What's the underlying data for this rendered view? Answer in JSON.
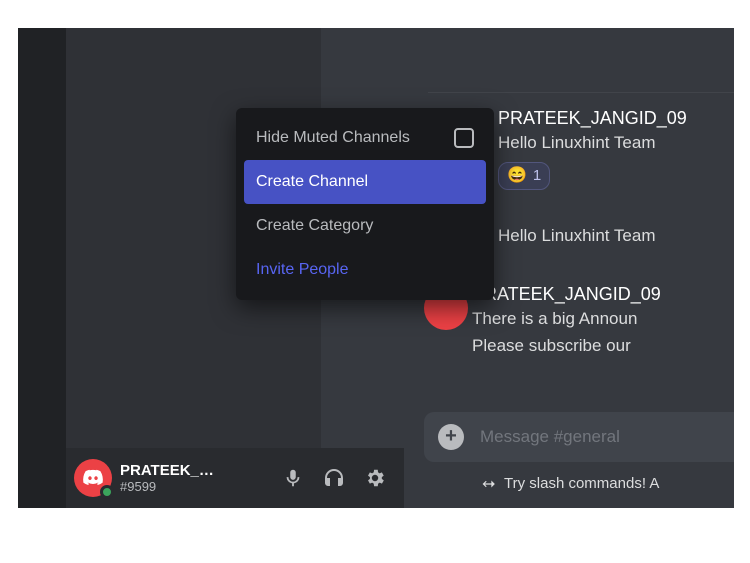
{
  "context_menu": {
    "items": [
      {
        "label": "Hide Muted Channels",
        "has_checkbox": true
      },
      {
        "label": "Create Channel",
        "active": true
      },
      {
        "label": "Create Category"
      },
      {
        "label": "Invite People",
        "variant": "invite"
      }
    ]
  },
  "user_panel": {
    "display_name": "PRATEEK_J...",
    "tag": "#9599"
  },
  "chat": {
    "messages": [
      {
        "author": "PRATEEK_JANGID_09",
        "body": "Hello Linuxhint Team",
        "reaction_emoji": "😄",
        "reaction_count": "1"
      },
      {
        "body_only": "Hello Linuxhint Team"
      },
      {
        "author": "PRATEEK_JANGID_09",
        "line1": "There is a big Announ",
        "line2": "Please subscribe our "
      }
    ],
    "input_placeholder": "Message #general",
    "slash_tip": "Try slash commands! A"
  }
}
